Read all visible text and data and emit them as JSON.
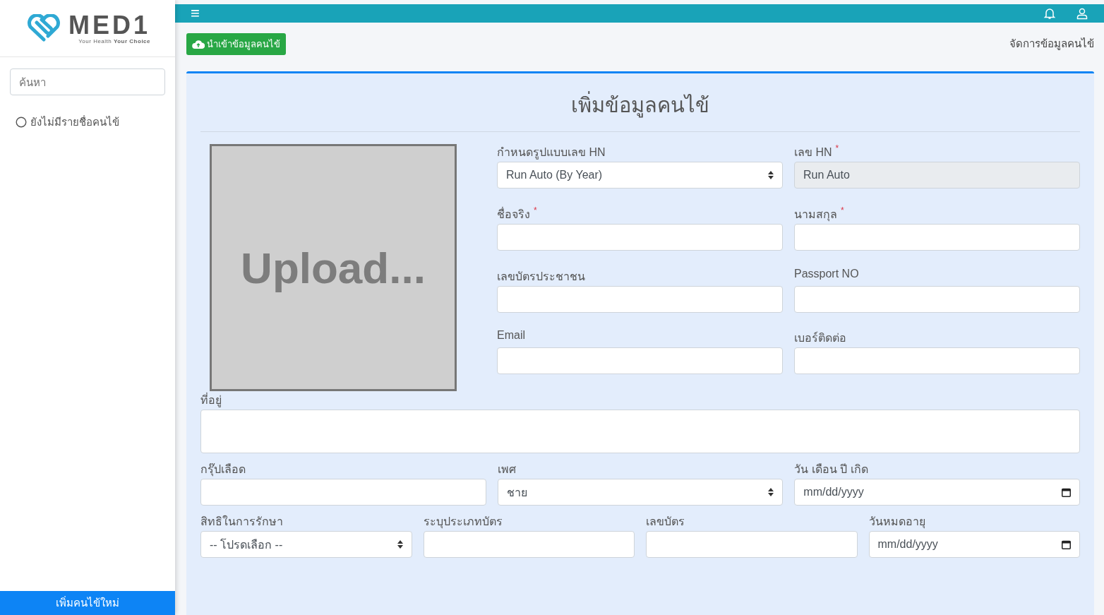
{
  "sidebar": {
    "logo": {
      "name": "MED1",
      "tagline_plain": "Your Health",
      "tagline_bold": "Your Choice"
    },
    "search": {
      "placeholder": "ค้นหา"
    },
    "empty_text": "ยังไม่มีรายชื่อคนไข้",
    "add_button": "เพิ่มคนไข้ใหม่"
  },
  "topbar": {
    "menu_icon": "≡"
  },
  "toolbar": {
    "import_button": "นำเข้าข้อมูลคนไข้",
    "breadcrumb": "จัดการข้อมูลคนไข้"
  },
  "form": {
    "title": "เพิ่มข้อมูลคนไข้",
    "upload_text": "Upload...",
    "side_fields": [
      {
        "label": "กำหนดรูปแบบเลข HN",
        "kind": "select",
        "value": "Run Auto (By Year)"
      },
      {
        "label": "เลข HN",
        "required_mark": "*",
        "kind": "readonly",
        "value": "Run Auto"
      },
      {
        "label": "ชื่อจริง",
        "required_mark": "*",
        "kind": "text"
      },
      {
        "label": "นามสกุล",
        "required_mark": "*",
        "kind": "text"
      },
      {
        "label": "เลขบัตรประชาชน",
        "kind": "text"
      },
      {
        "label": "Passport NO",
        "kind": "text"
      },
      {
        "label": "Email",
        "kind": "text"
      },
      {
        "label": "เบอร์ติดต่อ",
        "kind": "text"
      }
    ],
    "address": {
      "label": "ที่อยู่",
      "kind": "textarea"
    },
    "row3": [
      {
        "label": "กรุ๊ปเลือด",
        "kind": "text"
      },
      {
        "label": "เพศ",
        "kind": "select",
        "value": "ชาย"
      },
      {
        "label": "วัน เดือน ปี เกิด",
        "kind": "date",
        "value": "mm/dd/yyyy"
      }
    ],
    "row4": [
      {
        "label": "สิทธิในการรักษา",
        "kind": "select",
        "value": "-- โปรดเลือก --"
      },
      {
        "label": "ระบุประเภทบัตร",
        "kind": "text"
      },
      {
        "label": "เลขบัตร",
        "kind": "text"
      },
      {
        "label": "วันหมดอายุ",
        "kind": "date",
        "value": "mm/dd/yyyy"
      }
    ]
  }
}
